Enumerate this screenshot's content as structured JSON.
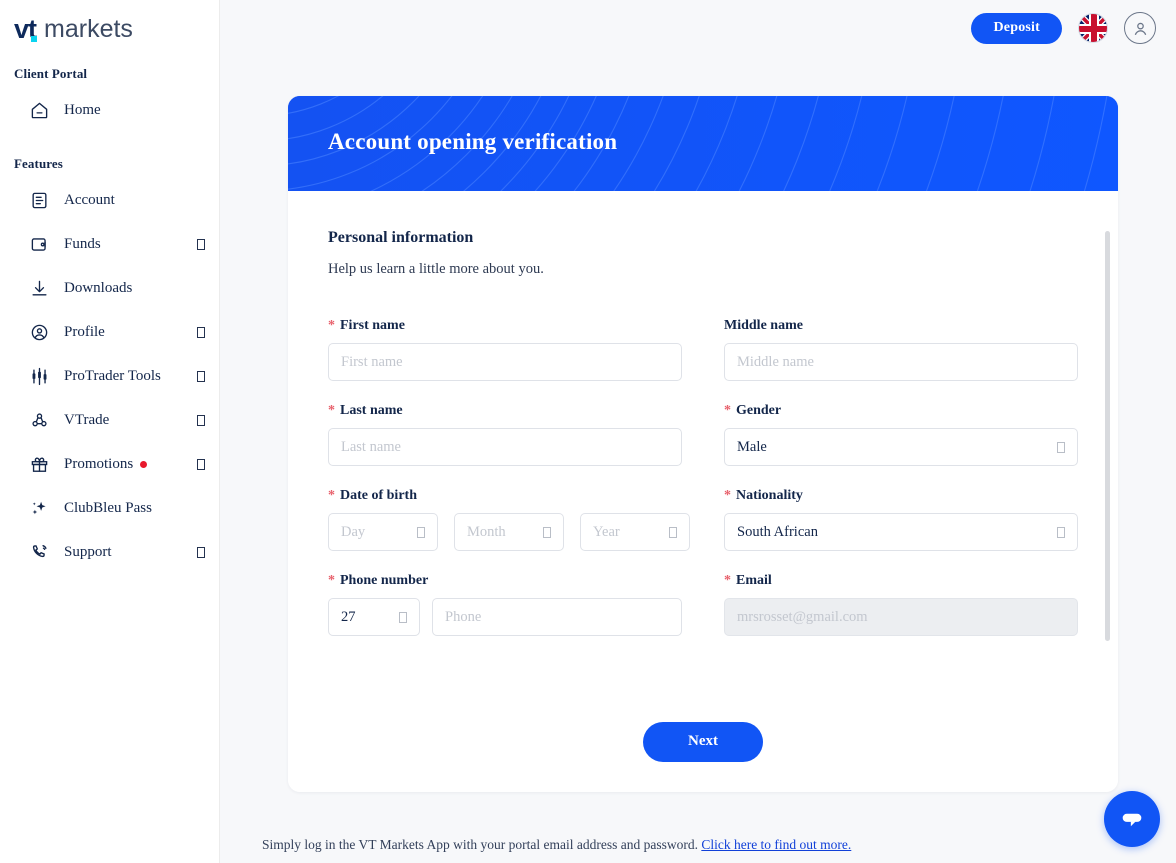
{
  "brand": {
    "logo_primary": "vt",
    "logo_secondary": "markets",
    "accent": "#0ad4f0",
    "navy": "#0e2a5c"
  },
  "colors": {
    "primary_blue": "#1155f5",
    "required_star": "#e8606b",
    "badge_red": "#e8192c"
  },
  "topbar": {
    "deposit_label": "Deposit",
    "flag_icon": "uk-flag-icon",
    "avatar_icon": "user-avatar-icon"
  },
  "sidebar": {
    "sections": [
      {
        "title": "Client Portal",
        "items": [
          {
            "label": "Home",
            "icon": "home-icon",
            "chevron": false,
            "badge": false
          }
        ]
      },
      {
        "title": "Features",
        "items": [
          {
            "label": "Account",
            "icon": "account-document-icon",
            "chevron": false,
            "badge": false
          },
          {
            "label": "Funds",
            "icon": "wallet-icon",
            "chevron": true,
            "badge": false
          },
          {
            "label": "Downloads",
            "icon": "download-icon",
            "chevron": false,
            "badge": false
          },
          {
            "label": "Profile",
            "icon": "profile-user-icon",
            "chevron": true,
            "badge": false
          },
          {
            "label": "ProTrader Tools",
            "icon": "candlestick-chart-icon",
            "chevron": true,
            "badge": false
          },
          {
            "label": "VTrade",
            "icon": "vtrade-nodes-icon",
            "chevron": true,
            "badge": false
          },
          {
            "label": "Promotions",
            "icon": "gift-icon",
            "chevron": true,
            "badge": true
          },
          {
            "label": "ClubBleu Pass",
            "icon": "sparkle-icon",
            "chevron": false,
            "badge": false
          },
          {
            "label": "Support",
            "icon": "phone-ringing-icon",
            "chevron": true,
            "badge": false
          }
        ]
      }
    ]
  },
  "card": {
    "header_title": "Account opening verification",
    "section_title": "Personal information",
    "section_subtitle": "Help us learn a little more about you.",
    "fields": {
      "first_name": {
        "label": "First name",
        "required": true,
        "placeholder": "First name",
        "value": ""
      },
      "middle_name": {
        "label": "Middle name",
        "required": false,
        "placeholder": "Middle name",
        "value": ""
      },
      "last_name": {
        "label": "Last name",
        "required": true,
        "placeholder": "Last name",
        "value": ""
      },
      "gender": {
        "label": "Gender",
        "required": true,
        "value": "Male"
      },
      "dob": {
        "label": "Date of birth",
        "required": true,
        "day_placeholder": "Day",
        "month_placeholder": "Month",
        "year_placeholder": "Year"
      },
      "nationality": {
        "label": "Nationality",
        "required": true,
        "value": "South African"
      },
      "phone": {
        "label": "Phone number",
        "required": true,
        "country_code": "27",
        "placeholder": "Phone",
        "value": ""
      },
      "email": {
        "label": "Email",
        "required": true,
        "value": "mrsrosset@gmail.com",
        "disabled": true
      }
    },
    "next_label": "Next"
  },
  "footer": {
    "text": "Simply log in the VT Markets App with your portal email address and password.",
    "link": "Click here to find out more."
  },
  "chat": {
    "icon": "chat-bubble-icon"
  }
}
